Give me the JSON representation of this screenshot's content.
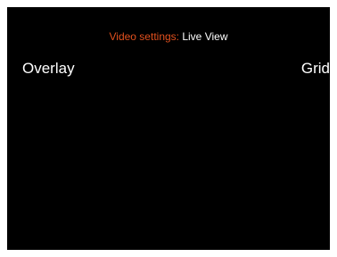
{
  "header": {
    "label": "Video settings:",
    "value": "Live View"
  },
  "setting": {
    "name": "Overlay",
    "value": "Grid"
  },
  "colors": {
    "background": "#000000",
    "accent": "#e1501e",
    "text": "#ffffff"
  }
}
